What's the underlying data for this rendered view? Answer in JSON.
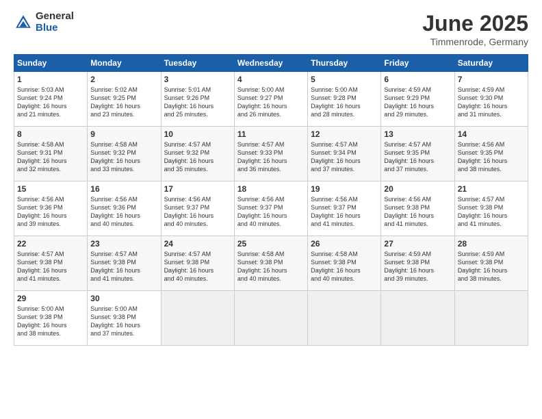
{
  "header": {
    "logo_general": "General",
    "logo_blue": "Blue",
    "title": "June 2025",
    "subtitle": "Timmenrode, Germany"
  },
  "weekdays": [
    "Sunday",
    "Monday",
    "Tuesday",
    "Wednesday",
    "Thursday",
    "Friday",
    "Saturday"
  ],
  "weeks": [
    [
      {
        "day": "1",
        "info": "Sunrise: 5:03 AM\nSunset: 9:24 PM\nDaylight: 16 hours\nand 21 minutes."
      },
      {
        "day": "2",
        "info": "Sunrise: 5:02 AM\nSunset: 9:25 PM\nDaylight: 16 hours\nand 23 minutes."
      },
      {
        "day": "3",
        "info": "Sunrise: 5:01 AM\nSunset: 9:26 PM\nDaylight: 16 hours\nand 25 minutes."
      },
      {
        "day": "4",
        "info": "Sunrise: 5:00 AM\nSunset: 9:27 PM\nDaylight: 16 hours\nand 26 minutes."
      },
      {
        "day": "5",
        "info": "Sunrise: 5:00 AM\nSunset: 9:28 PM\nDaylight: 16 hours\nand 28 minutes."
      },
      {
        "day": "6",
        "info": "Sunrise: 4:59 AM\nSunset: 9:29 PM\nDaylight: 16 hours\nand 29 minutes."
      },
      {
        "day": "7",
        "info": "Sunrise: 4:59 AM\nSunset: 9:30 PM\nDaylight: 16 hours\nand 31 minutes."
      }
    ],
    [
      {
        "day": "8",
        "info": "Sunrise: 4:58 AM\nSunset: 9:31 PM\nDaylight: 16 hours\nand 32 minutes."
      },
      {
        "day": "9",
        "info": "Sunrise: 4:58 AM\nSunset: 9:32 PM\nDaylight: 16 hours\nand 33 minutes."
      },
      {
        "day": "10",
        "info": "Sunrise: 4:57 AM\nSunset: 9:32 PM\nDaylight: 16 hours\nand 35 minutes."
      },
      {
        "day": "11",
        "info": "Sunrise: 4:57 AM\nSunset: 9:33 PM\nDaylight: 16 hours\nand 36 minutes."
      },
      {
        "day": "12",
        "info": "Sunrise: 4:57 AM\nSunset: 9:34 PM\nDaylight: 16 hours\nand 37 minutes."
      },
      {
        "day": "13",
        "info": "Sunrise: 4:57 AM\nSunset: 9:35 PM\nDaylight: 16 hours\nand 37 minutes."
      },
      {
        "day": "14",
        "info": "Sunrise: 4:56 AM\nSunset: 9:35 PM\nDaylight: 16 hours\nand 38 minutes."
      }
    ],
    [
      {
        "day": "15",
        "info": "Sunrise: 4:56 AM\nSunset: 9:36 PM\nDaylight: 16 hours\nand 39 minutes."
      },
      {
        "day": "16",
        "info": "Sunrise: 4:56 AM\nSunset: 9:36 PM\nDaylight: 16 hours\nand 40 minutes."
      },
      {
        "day": "17",
        "info": "Sunrise: 4:56 AM\nSunset: 9:37 PM\nDaylight: 16 hours\nand 40 minutes."
      },
      {
        "day": "18",
        "info": "Sunrise: 4:56 AM\nSunset: 9:37 PM\nDaylight: 16 hours\nand 40 minutes."
      },
      {
        "day": "19",
        "info": "Sunrise: 4:56 AM\nSunset: 9:37 PM\nDaylight: 16 hours\nand 41 minutes."
      },
      {
        "day": "20",
        "info": "Sunrise: 4:56 AM\nSunset: 9:38 PM\nDaylight: 16 hours\nand 41 minutes."
      },
      {
        "day": "21",
        "info": "Sunrise: 4:57 AM\nSunset: 9:38 PM\nDaylight: 16 hours\nand 41 minutes."
      }
    ],
    [
      {
        "day": "22",
        "info": "Sunrise: 4:57 AM\nSunset: 9:38 PM\nDaylight: 16 hours\nand 41 minutes."
      },
      {
        "day": "23",
        "info": "Sunrise: 4:57 AM\nSunset: 9:38 PM\nDaylight: 16 hours\nand 41 minutes."
      },
      {
        "day": "24",
        "info": "Sunrise: 4:57 AM\nSunset: 9:38 PM\nDaylight: 16 hours\nand 40 minutes."
      },
      {
        "day": "25",
        "info": "Sunrise: 4:58 AM\nSunset: 9:38 PM\nDaylight: 16 hours\nand 40 minutes."
      },
      {
        "day": "26",
        "info": "Sunrise: 4:58 AM\nSunset: 9:38 PM\nDaylight: 16 hours\nand 40 minutes."
      },
      {
        "day": "27",
        "info": "Sunrise: 4:59 AM\nSunset: 9:38 PM\nDaylight: 16 hours\nand 39 minutes."
      },
      {
        "day": "28",
        "info": "Sunrise: 4:59 AM\nSunset: 9:38 PM\nDaylight: 16 hours\nand 38 minutes."
      }
    ],
    [
      {
        "day": "29",
        "info": "Sunrise: 5:00 AM\nSunset: 9:38 PM\nDaylight: 16 hours\nand 38 minutes."
      },
      {
        "day": "30",
        "info": "Sunrise: 5:00 AM\nSunset: 9:38 PM\nDaylight: 16 hours\nand 37 minutes."
      },
      {
        "day": "",
        "info": ""
      },
      {
        "day": "",
        "info": ""
      },
      {
        "day": "",
        "info": ""
      },
      {
        "day": "",
        "info": ""
      },
      {
        "day": "",
        "info": ""
      }
    ]
  ]
}
